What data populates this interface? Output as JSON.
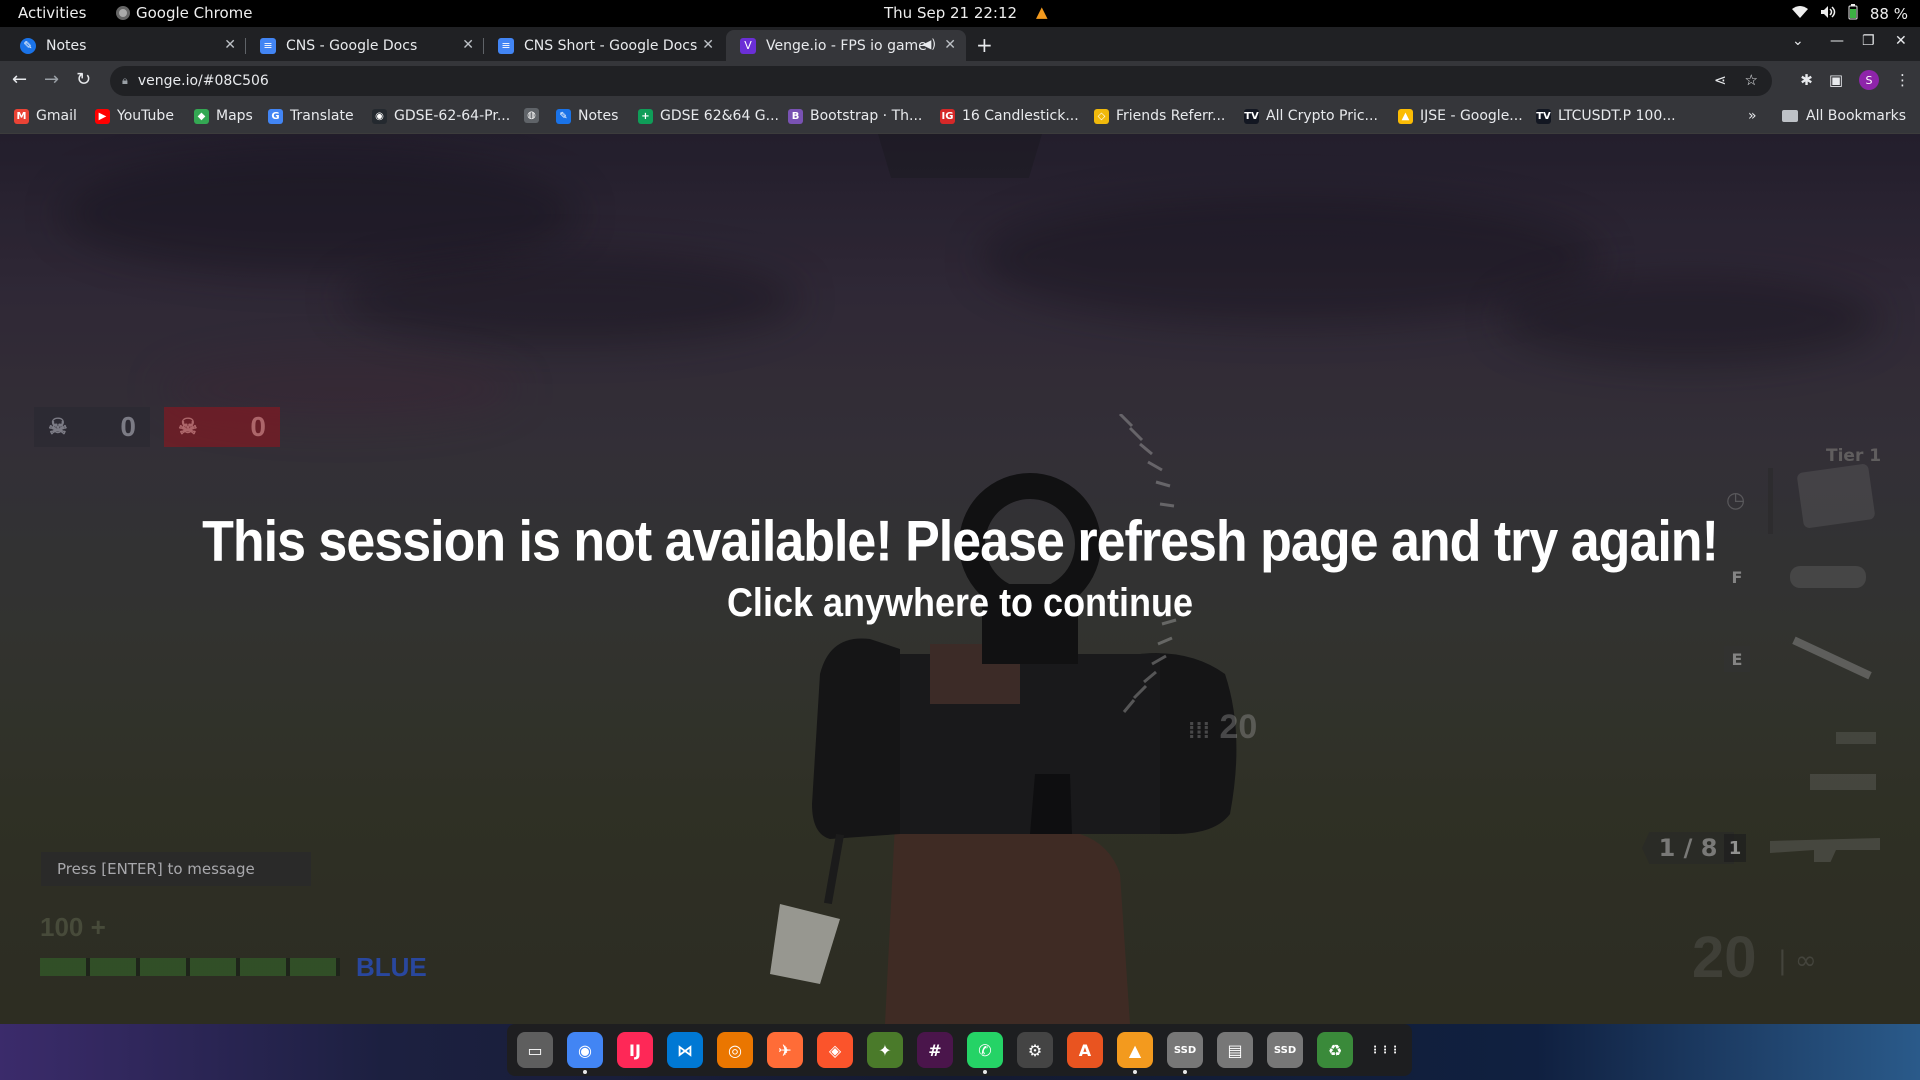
{
  "system_bar": {
    "activities": "Activities",
    "app_name": "Google Chrome",
    "clock": "Thu Sep 21  22:12",
    "battery": "88 %"
  },
  "tabs": [
    {
      "title": "Notes",
      "icon": "notes-icon",
      "active": false
    },
    {
      "title": "CNS - Google Docs",
      "icon": "docs-icon",
      "active": false
    },
    {
      "title": "CNS Short - Google Docs",
      "icon": "docs-icon",
      "active": false
    },
    {
      "title": "Venge.io - FPS io game",
      "icon": "venge-icon",
      "active": true
    }
  ],
  "address_bar": {
    "url": "venge.io/#08C506"
  },
  "bookmarks": [
    {
      "label": "Gmail",
      "color": "#ea4335",
      "glyph": "M"
    },
    {
      "label": "YouTube",
      "color": "#ff0000",
      "glyph": "▶"
    },
    {
      "label": "Maps",
      "color": "#34a853",
      "glyph": "◆"
    },
    {
      "label": "Translate",
      "color": "#4285f4",
      "glyph": "G"
    },
    {
      "label": "GDSE-62-64-Pr...",
      "color": "#24292f",
      "glyph": "◉"
    },
    {
      "label": "",
      "color": "#5f6368",
      "glyph": "◍"
    },
    {
      "label": "Notes",
      "color": "#1a73e8",
      "glyph": "✎"
    },
    {
      "label": "GDSE 62&64 G...",
      "color": "#0f9d58",
      "glyph": "+"
    },
    {
      "label": "Bootstrap · Th...",
      "color": "#7952b3",
      "glyph": "B"
    },
    {
      "label": "16 Candlestick...",
      "color": "#d62828",
      "glyph": "IG"
    },
    {
      "label": "Friends Referr...",
      "color": "#f0b90b",
      "glyph": "◇"
    },
    {
      "label": "All Crypto Pric...",
      "color": "#131722",
      "glyph": "TV"
    },
    {
      "label": "IJSE - Google...",
      "color": "#fbbc04",
      "glyph": "▲"
    },
    {
      "label": "LTCUSDT.P 100...",
      "color": "#131722",
      "glyph": "TV"
    }
  ],
  "all_bookmarks": "All Bookmarks",
  "game": {
    "message": "This session is not available! Please refresh page and try again!",
    "submessage": "Click anywhere to continue",
    "blue_score": "0",
    "red_score": "0",
    "chat_placeholder": "Press [ENTER] to message",
    "health": "100 +",
    "team": "BLUE",
    "tier": "Tier 1",
    "key_f": "F",
    "key_e": "E",
    "ammo": "1 / 8",
    "slot": "1",
    "scope_ammo": "20",
    "big_ammo": "20",
    "inf_ammo": "| ∞"
  },
  "dock": [
    {
      "name": "files",
      "color": "#5e5e5e",
      "glyph": "▭",
      "running": false
    },
    {
      "name": "chrome",
      "color": "#4285f4",
      "glyph": "◉",
      "running": true
    },
    {
      "name": "intellij",
      "color": "#fe2857",
      "glyph": "IJ",
      "running": false
    },
    {
      "name": "vscode",
      "color": "#0078d4",
      "glyph": "⋈",
      "running": false
    },
    {
      "name": "blender",
      "color": "#ea7600",
      "glyph": "◎",
      "running": false
    },
    {
      "name": "postman",
      "color": "#ff6c37",
      "glyph": "✈",
      "running": false
    },
    {
      "name": "brave",
      "color": "#fb542b",
      "glyph": "◈",
      "running": false
    },
    {
      "name": "geany",
      "color": "#4a7a2a",
      "glyph": "✦",
      "running": false
    },
    {
      "name": "slack",
      "color": "#4a154b",
      "glyph": "#",
      "running": false
    },
    {
      "name": "whatsapp",
      "color": "#25d366",
      "glyph": "✆",
      "running": true
    },
    {
      "name": "settings",
      "color": "#444",
      "glyph": "⚙",
      "running": false
    },
    {
      "name": "software",
      "color": "#e95420",
      "glyph": "A",
      "running": false
    },
    {
      "name": "vlc",
      "color": "#f39a1e",
      "glyph": "▲",
      "running": true
    },
    {
      "name": "ssd-1",
      "color": "#777",
      "glyph": "SSD",
      "running": true
    },
    {
      "name": "drive",
      "color": "#777",
      "glyph": "▤",
      "running": false
    },
    {
      "name": "ssd-2",
      "color": "#777",
      "glyph": "SSD",
      "running": false
    },
    {
      "name": "trash",
      "color": "#3a8a3a",
      "glyph": "♻",
      "running": false
    },
    {
      "name": "app-grid",
      "color": "transparent",
      "glyph": "⋮⋮⋮",
      "running": false
    }
  ]
}
